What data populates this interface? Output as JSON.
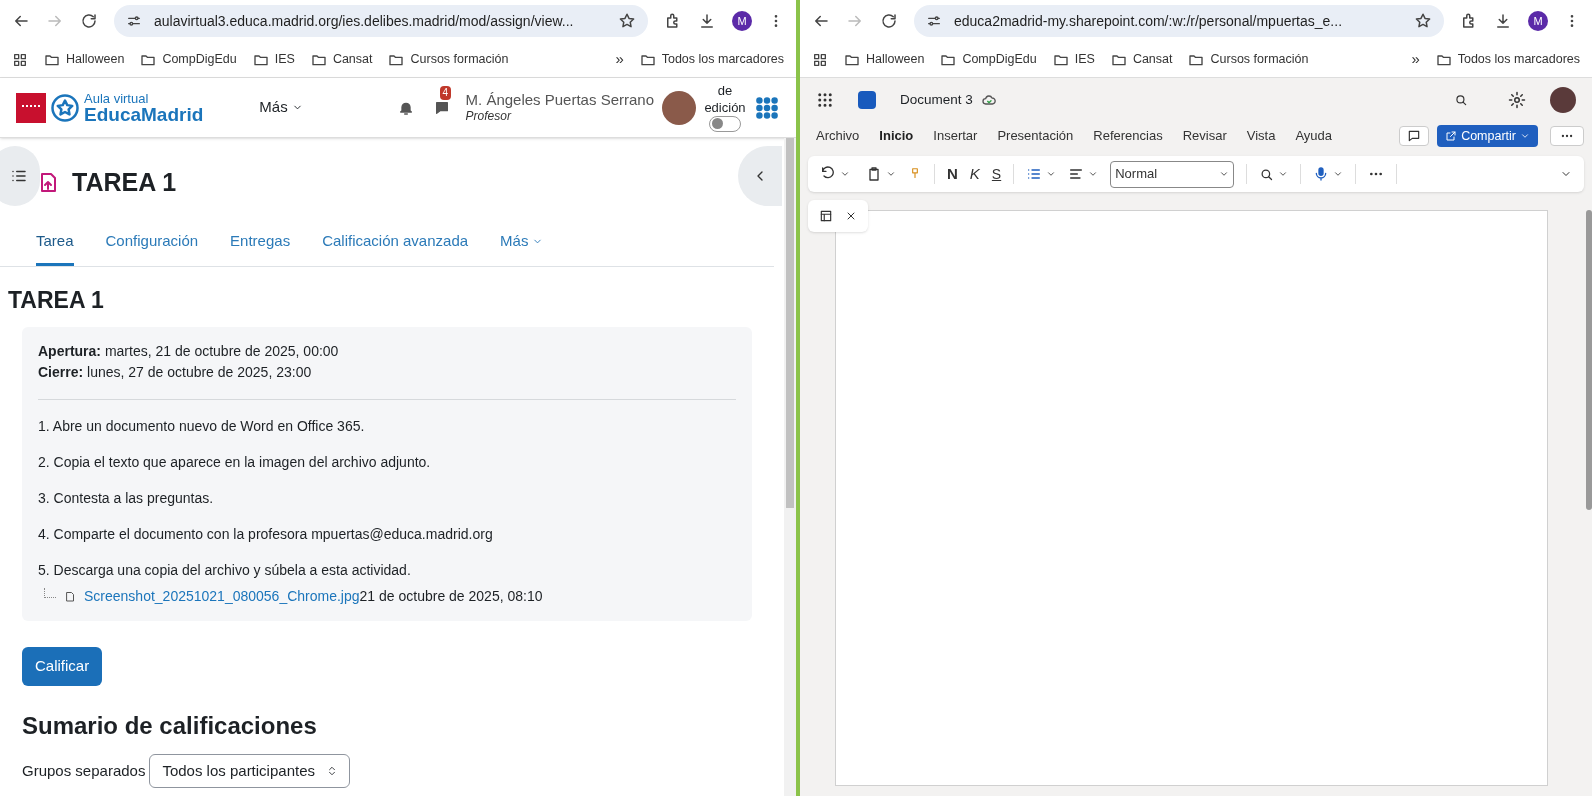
{
  "left_browser": {
    "url": "aulavirtual3.educa.madrid.org/ies.delibes.madrid/mod/assign/view...",
    "profile": "M",
    "bookmarks": [
      "Halloween",
      "CompDigEdu",
      "IES",
      "Cansat",
      "Cursos formación"
    ],
    "more_bookmarks": "»",
    "all_bookmarks": "Todos los marcadores"
  },
  "moodle": {
    "logo_top": "Aula virtual",
    "logo_bottom": "EducaMadrid",
    "more_menu": "Más",
    "message_count": "4",
    "user_name": "M. Ángeles Puertas Serrano",
    "user_role": "Profesor",
    "edit_mode_label": "de edición",
    "edit_mode_on": false,
    "title": "TAREA 1",
    "tabs": [
      {
        "label": "Tarea",
        "selected": true
      },
      {
        "label": "Configuración",
        "selected": false
      },
      {
        "label": "Entregas",
        "selected": false
      },
      {
        "label": "Calificación avanzada",
        "selected": false
      },
      {
        "label": "Más",
        "selected": false
      }
    ],
    "heading": "TAREA 1",
    "dates": [
      "**Apertura:** martes, 21 de octubre de 2025, 00:00",
      "**Cierre:** lunes, 27 de octubre de 2025, 23:00"
    ],
    "steps": [
      "1. Abre un documento nuevo de Word en Office 365.",
      "2. Copia el texto que aparece en la imagen del archivo adjunto.",
      "3. Contesta a las preguntas.",
      "4. Comparte el documento con la profesora mpuertas@educa.madrid.org",
      "5. Descarga una copia del archivo y súbela a esta actividad."
    ],
    "attachment": {
      "name": "Screenshot_20251021_080056_Chrome.jpg",
      "date": "21 de octubre de 2025, 08:10"
    },
    "grade_button": "Calificar",
    "summary_heading": "Sumario de calificaciones",
    "groups_label": "Grupos separados",
    "groups_value": "Todos los participantes"
  },
  "right_browser": {
    "url": "educa2madrid-my.sharepoint.com/:w:/r/personal/mpuertas_e...",
    "profile": "M",
    "bookmarks": [
      "Halloween",
      "CompDigEdu",
      "IES",
      "Cansat",
      "Cursos formación"
    ],
    "more_bookmarks": "»",
    "all_bookmarks": "Todos los marcadores"
  },
  "word": {
    "doc_title": "Document 3",
    "menu": [
      {
        "label": "Archivo",
        "selected": false
      },
      {
        "label": "Inicio",
        "selected": true
      },
      {
        "label": "Insertar",
        "selected": false
      },
      {
        "label": "Presentación",
        "selected": false
      },
      {
        "label": "Referencias",
        "selected": false
      },
      {
        "label": "Revisar",
        "selected": false
      },
      {
        "label": "Vista",
        "selected": false
      },
      {
        "label": "Ayuda",
        "selected": false
      }
    ],
    "share_button": "Compartir",
    "bold": "N",
    "italic": "K",
    "strike": "S",
    "style": "Normal"
  }
}
